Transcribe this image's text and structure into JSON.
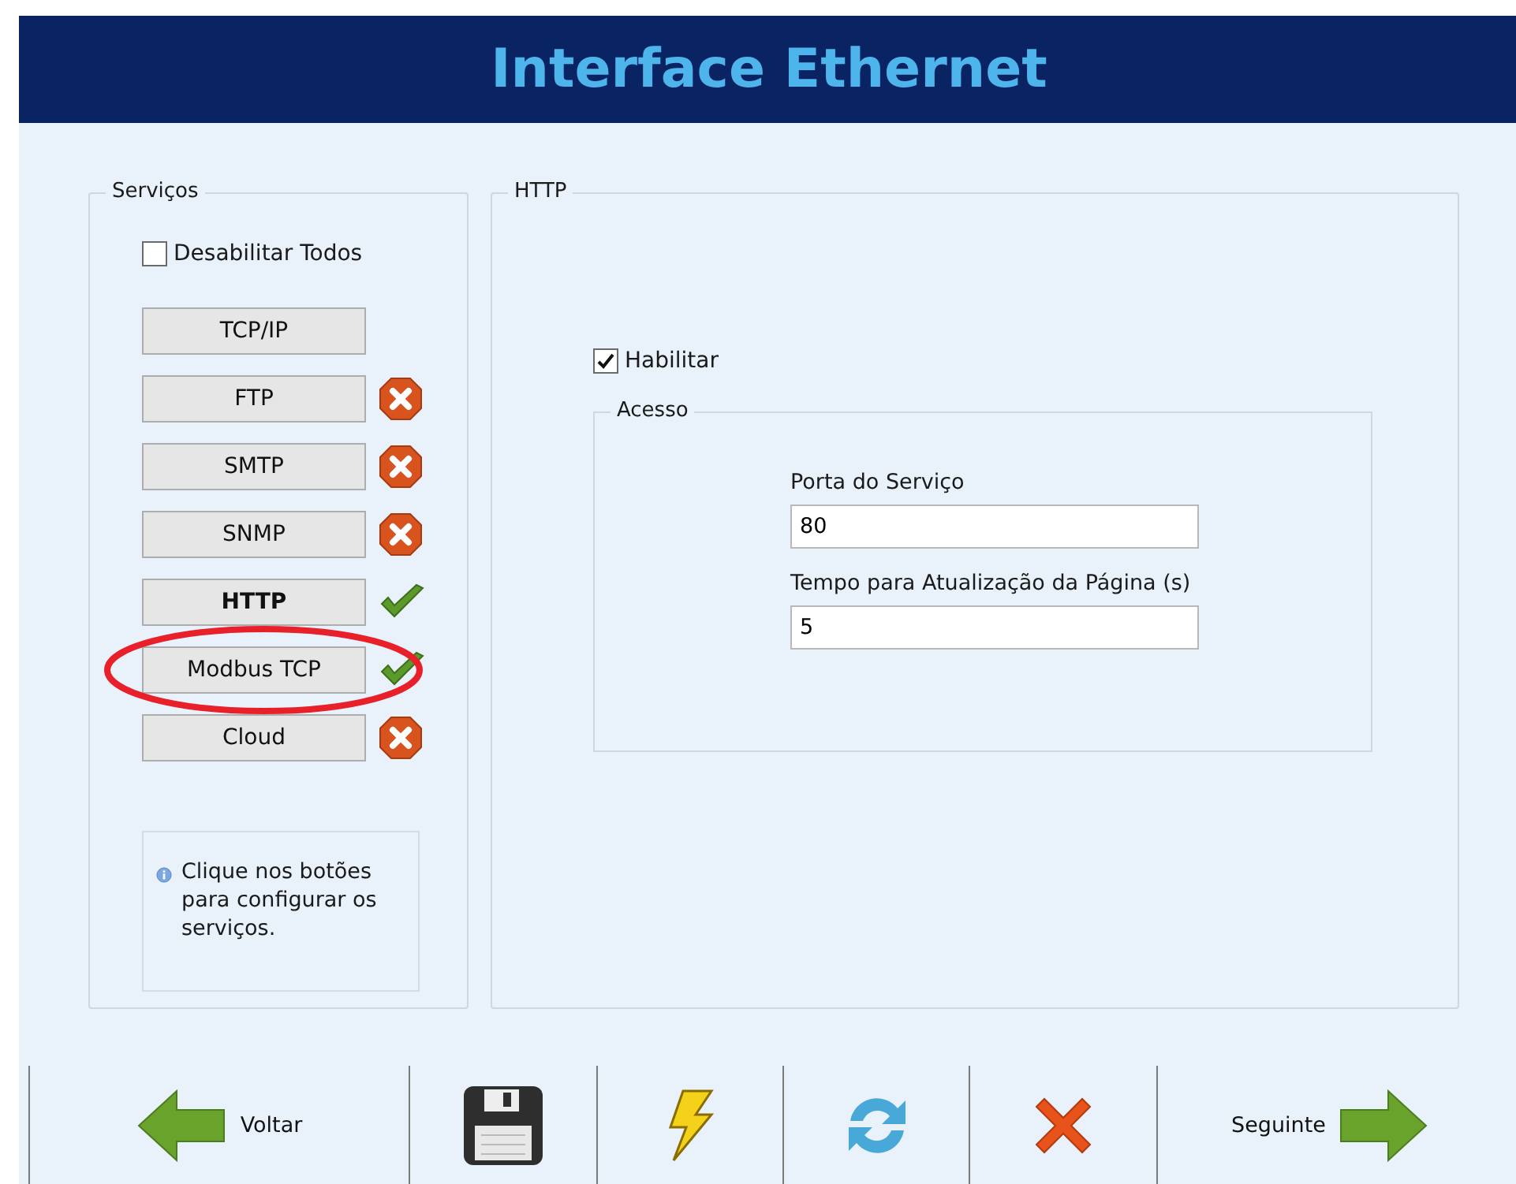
{
  "header": {
    "title": "Interface Ethernet"
  },
  "services": {
    "legend": "Serviços",
    "disable_all": {
      "label": "Desabilitar Todos",
      "checked": false
    },
    "items": [
      {
        "label": "TCP/IP",
        "selected": false,
        "kind": "none"
      },
      {
        "label": "FTP",
        "selected": false,
        "kind": "error"
      },
      {
        "label": "SMTP",
        "selected": false,
        "kind": "error"
      },
      {
        "label": "SNMP",
        "selected": false,
        "kind": "error"
      },
      {
        "label": "HTTP",
        "selected": true,
        "kind": "ok"
      },
      {
        "label": "Modbus TCP",
        "selected": false,
        "kind": "ok",
        "annotated": true
      },
      {
        "label": "Cloud",
        "selected": false,
        "kind": "error"
      }
    ],
    "info": "Clique nos botões para configurar os serviços."
  },
  "detail": {
    "legend": "HTTP",
    "enable": {
      "label": "Habilitar",
      "checked": true
    },
    "access": {
      "legend": "Acesso",
      "fields": [
        {
          "label": "Porta do Serviço",
          "value": "80"
        },
        {
          "label": "Tempo para Atualização da Página (s)",
          "value": "5"
        }
      ]
    }
  },
  "toolbar": [
    {
      "kind": "back",
      "label": "Voltar"
    },
    {
      "kind": "save"
    },
    {
      "kind": "apply"
    },
    {
      "kind": "refresh"
    },
    {
      "kind": "cancel"
    },
    {
      "kind": "next",
      "label": "Seguinte"
    }
  ]
}
